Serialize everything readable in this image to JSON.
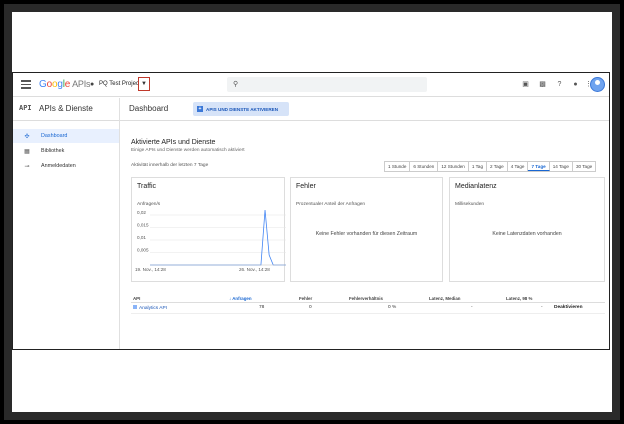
{
  "topbar": {
    "logo_google": [
      "G",
      "o",
      "o",
      "g",
      "l",
      "e"
    ],
    "logo_apis": "APIs",
    "project_name": "PQ Test Project",
    "search_placeholder": ""
  },
  "subbar": {
    "api_badge": "API",
    "section_title": "APIs & Dienste",
    "page_title": "Dashboard",
    "enable_button": "APIS UND DIENSTE AKTIVIEREN"
  },
  "sidebar": {
    "items": [
      {
        "label": "Dashboard",
        "icon": "dashboard-icon",
        "active": true
      },
      {
        "label": "Bibliothek",
        "icon": "library-icon",
        "active": false
      },
      {
        "label": "Anmeldedaten",
        "icon": "key-icon",
        "active": false
      }
    ]
  },
  "main": {
    "heading": "Aktivierte APIs und Dienste",
    "subheading": "Einige APIs und Dienste werden automatisch aktiviert",
    "range_label": "Aktivität innerhalb der letzten 7 Tage",
    "ranges": [
      "1 Stunde",
      "6 Stunden",
      "12 Stunden",
      "1 Tag",
      "2 Tage",
      "4 Tage",
      "7 Tage",
      "14 Tage",
      "30 Tage"
    ],
    "selected_range": "7 Tage"
  },
  "cards": {
    "traffic": {
      "title": "Traffic",
      "subtitle": "Anfragen/s"
    },
    "errors": {
      "title": "Fehler",
      "subtitle": "Prozentualer Anteil der Anfragen",
      "message": "Keine Fehler vorhanden für diesen Zeitraum"
    },
    "latency": {
      "title": "Medianlatenz",
      "subtitle": "Millisekunden",
      "message": "Keine Latenzdaten vorhanden"
    }
  },
  "chart_data": {
    "type": "line",
    "title": "Traffic",
    "ylabel": "Anfragen/s",
    "xlabel": "",
    "x_ticks": [
      "19. Nov., 14:28",
      "26. Nov., 14:28"
    ],
    "y_ticks": [
      "0,02",
      "0,015",
      "0,01",
      "0,005"
    ],
    "ylim": [
      0,
      0.022
    ],
    "grid": true,
    "series": [
      {
        "values": [
          0,
          0,
          0,
          0,
          0,
          0,
          0,
          0,
          0,
          0,
          0,
          0,
          0,
          0,
          0,
          0,
          0,
          0,
          0,
          0,
          0,
          0,
          0,
          0,
          0,
          0,
          0,
          0,
          0.023,
          0.004,
          0,
          0,
          0,
          0,
          0,
          0,
          0.002,
          0
        ]
      }
    ]
  },
  "table": {
    "headers": [
      "API",
      "Anfragen",
      "Fehler",
      "Fehlerverhältnis",
      "Latenz, Median",
      "Latenz, 98 %"
    ],
    "rows": [
      {
        "api": "Analytics API",
        "requests": "78",
        "errors": "0",
        "error_ratio": "0 %",
        "latency_median": "-",
        "latency_98": "-",
        "action": "Deaktivieren"
      }
    ]
  },
  "colors": {
    "accent": "#1967d2",
    "chart_line": "#4285f4"
  }
}
